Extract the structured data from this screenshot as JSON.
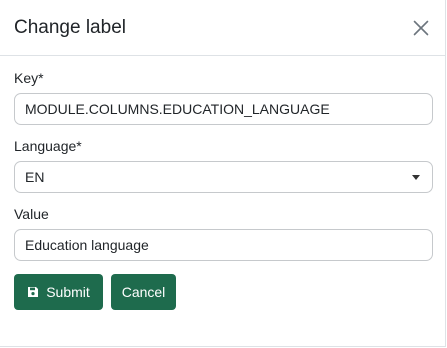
{
  "dialog": {
    "title": "Change label",
    "close_icon": "close-icon"
  },
  "form": {
    "key": {
      "label": "Key*",
      "value": "MODULE.COLUMNS.EDUCATION_LANGUAGE"
    },
    "language": {
      "label": "Language*",
      "selected": "EN",
      "caret_icon": "caret-down-icon"
    },
    "value": {
      "label": "Value",
      "value": "Education language"
    }
  },
  "actions": {
    "submit_label": "Submit",
    "submit_icon": "save-icon",
    "cancel_label": "Cancel"
  },
  "colors": {
    "primary": "#1e6b4d",
    "border": "#c6c9cc",
    "text": "#212529"
  }
}
